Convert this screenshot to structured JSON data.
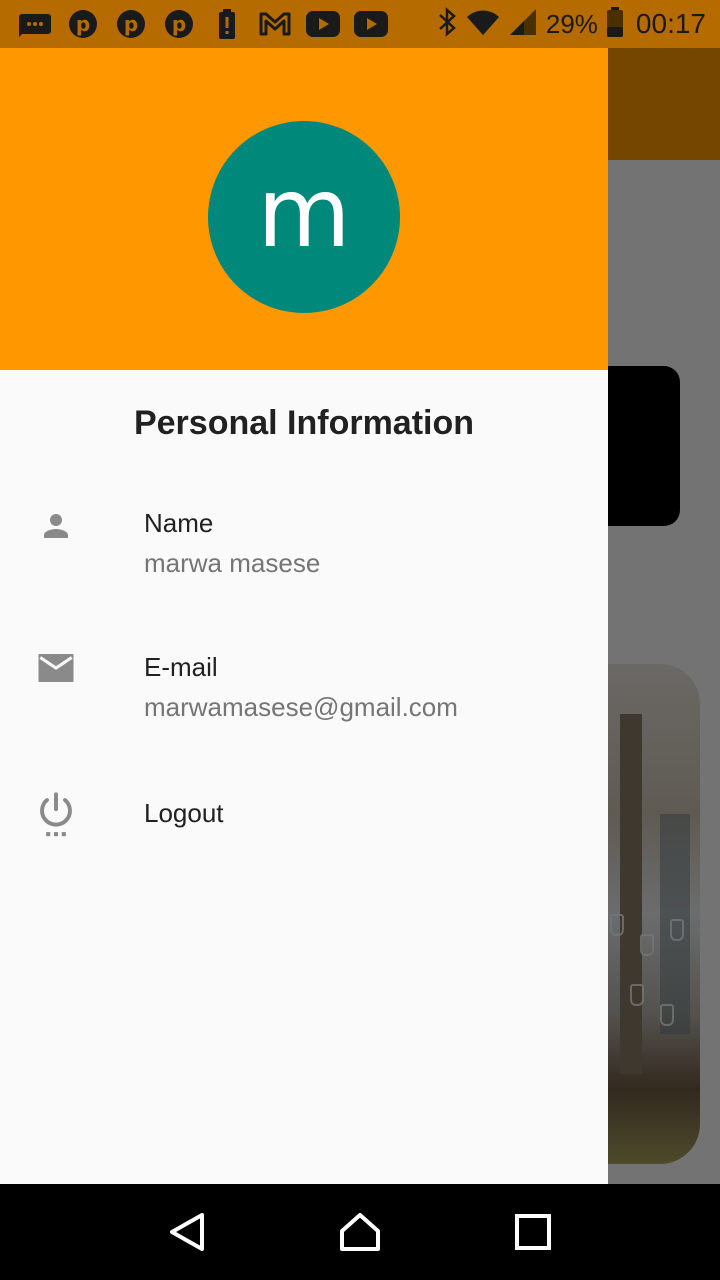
{
  "status_bar": {
    "notification_icons": [
      "chat-bubble-icon",
      "pinterest-icon",
      "pinterest-icon",
      "pinterest-icon",
      "battery-alert-icon",
      "gmail-icon",
      "youtube-icon",
      "youtube-icon"
    ],
    "battery_percent": "29%",
    "time": "00:17"
  },
  "drawer": {
    "avatar_letter": "m",
    "section_title": "Personal Information",
    "items": [
      {
        "icon": "person-icon",
        "title": "Name",
        "subtitle": "marwa masese"
      },
      {
        "icon": "email-icon",
        "title": "E-mail",
        "subtitle": "marwamasese@gmail.com"
      },
      {
        "icon": "power-icon",
        "title": "Logout"
      }
    ]
  },
  "colors": {
    "header": "#ff9800",
    "avatar": "#00897b",
    "drawer_bg": "#fafafa",
    "icon_gray": "#8a8a8a"
  },
  "navigation": [
    "back-icon",
    "home-icon",
    "recents-icon"
  ]
}
